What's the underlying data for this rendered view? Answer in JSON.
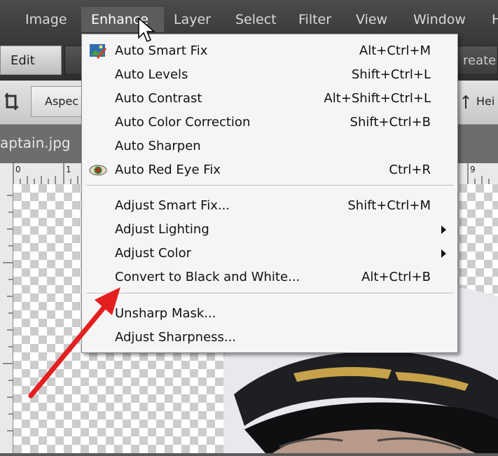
{
  "menubar": {
    "items": [
      "Image",
      "Enhance",
      "Layer",
      "Select",
      "Filter",
      "View",
      "Window",
      "H"
    ],
    "active": "Enhance"
  },
  "modebar": {
    "edit": "Edit",
    "create": "reate"
  },
  "options": {
    "aspect": "Aspec",
    "height": "Hei"
  },
  "document": {
    "title": "aptain.jpg"
  },
  "ruler": {
    "marks": [
      "0",
      "1",
      "9"
    ]
  },
  "enhance_menu": {
    "auto": [
      {
        "label": "Auto Smart Fix",
        "shortcut": "Alt+Ctrl+M",
        "icon": "smart-fix-icon"
      },
      {
        "label": "Auto Levels",
        "shortcut": "Shift+Ctrl+L"
      },
      {
        "label": "Auto Contrast",
        "shortcut": "Alt+Shift+Ctrl+L"
      },
      {
        "label": "Auto Color Correction",
        "shortcut": "Shift+Ctrl+B"
      },
      {
        "label": "Auto Sharpen",
        "shortcut": ""
      },
      {
        "label": "Auto Red Eye Fix",
        "shortcut": "Ctrl+R",
        "icon": "red-eye-icon"
      }
    ],
    "adjust": [
      {
        "label": "Adjust Smart Fix...",
        "shortcut": "Shift+Ctrl+M"
      },
      {
        "label": "Adjust Lighting",
        "shortcut": "",
        "submenu": true
      },
      {
        "label": "Adjust Color",
        "shortcut": "",
        "submenu": true
      },
      {
        "label": "Convert to Black and White...",
        "shortcut": "Alt+Ctrl+B"
      }
    ],
    "sharpen": [
      {
        "label": "Unsharp Mask...",
        "shortcut": ""
      },
      {
        "label": "Adjust Sharpness...",
        "shortcut": ""
      }
    ]
  },
  "annotation": {
    "arrow_color": "#e41f1f"
  },
  "colors": {
    "menubar": "#404040",
    "menu_bg": "#f5f5f5",
    "highlight": "#5c5c5c"
  }
}
